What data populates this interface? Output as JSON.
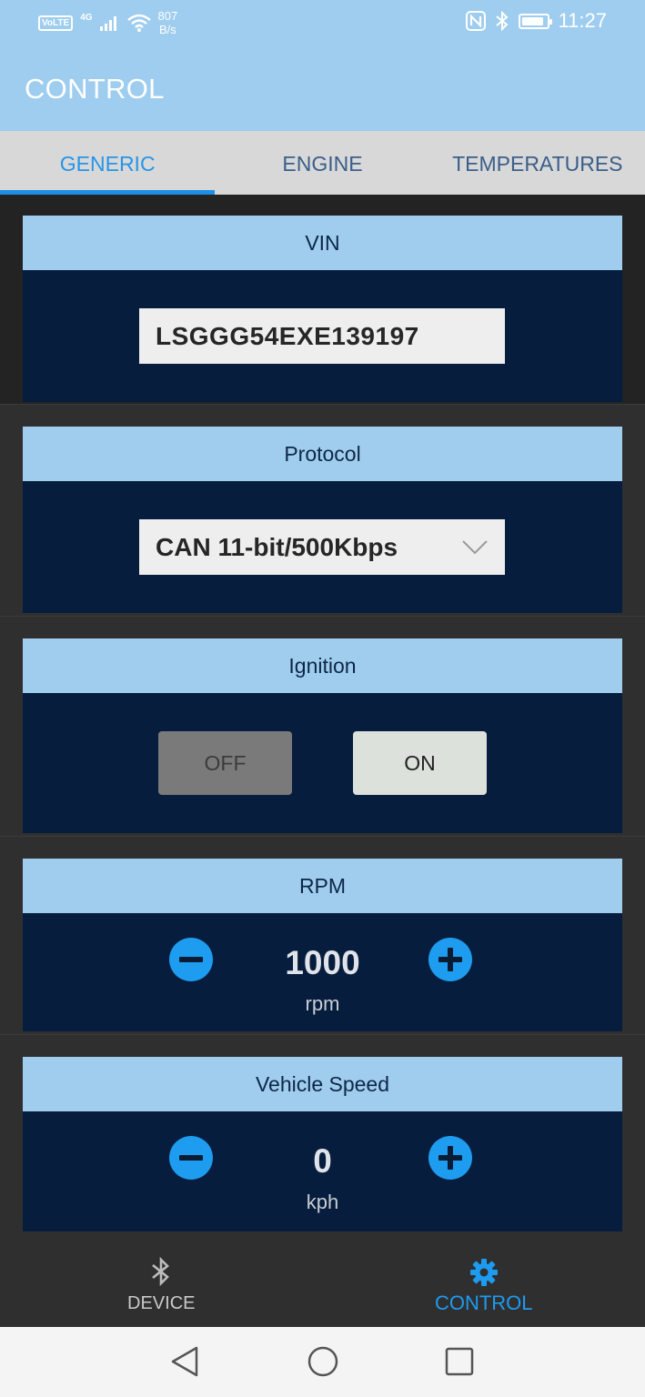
{
  "status_bar": {
    "volte": "VoLTE",
    "network": "4G",
    "speed_value": "807",
    "speed_unit": "B/s",
    "time": "11:27",
    "battery_level": 0.9
  },
  "app_bar": {
    "title": "CONTROL"
  },
  "tabs": [
    {
      "label": "GENERIC",
      "active": true
    },
    {
      "label": "ENGINE",
      "active": false
    },
    {
      "label": "TEMPERATURES",
      "active": false
    }
  ],
  "vin": {
    "header": "VIN",
    "value": "LSGGG54EXE139197"
  },
  "protocol": {
    "header": "Protocol",
    "selected": "CAN 11-bit/500Kbps"
  },
  "ignition": {
    "header": "Ignition",
    "off_label": "OFF",
    "on_label": "ON",
    "state": "ON"
  },
  "rpm": {
    "header": "RPM",
    "value": "1000",
    "unit": "rpm"
  },
  "vehicle_speed": {
    "header": "Vehicle Speed",
    "value": "0",
    "unit": "kph"
  },
  "bottom_nav": [
    {
      "label": "DEVICE",
      "icon": "bluetooth-icon",
      "active": false
    },
    {
      "label": "CONTROL",
      "icon": "gear-icon",
      "active": true
    }
  ],
  "colors": {
    "app_bar": "#9ecdef",
    "accent": "#1f8ee6",
    "card_body": "#071d3d",
    "card_header": "#a0cdee",
    "round_button": "#1e9cf0"
  }
}
